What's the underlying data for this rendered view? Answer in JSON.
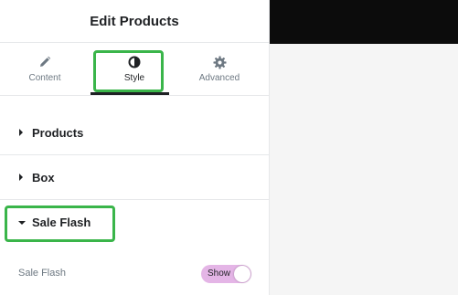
{
  "header": {
    "title": "Edit Products"
  },
  "tabs": [
    {
      "label": "Content",
      "icon": "pencil-icon"
    },
    {
      "label": "Style",
      "icon": "half-circle-icon",
      "active": true
    },
    {
      "label": "Advanced",
      "icon": "gear-icon"
    }
  ],
  "sections": [
    {
      "label": "Products",
      "expanded": false
    },
    {
      "label": "Box",
      "expanded": false
    },
    {
      "label": "Sale Flash",
      "expanded": true
    }
  ],
  "sale_flash_control": {
    "label": "Sale Flash",
    "toggle_label": "Show",
    "on": true
  },
  "colors": {
    "highlight": "#3ab54a",
    "toggle": "#e4b5e6",
    "preview_top": "#0c0c0c"
  }
}
